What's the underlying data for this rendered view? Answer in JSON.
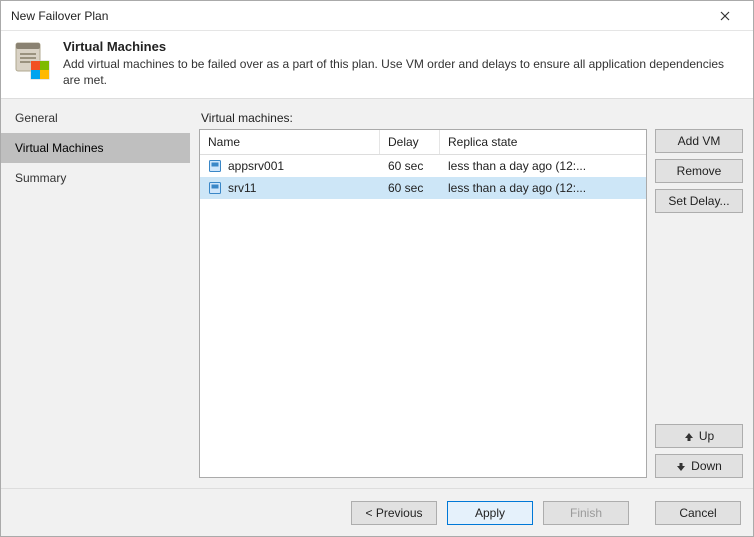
{
  "window": {
    "title": "New Failover Plan"
  },
  "header": {
    "title": "Virtual Machines",
    "description": "Add virtual machines to be failed over as a part of this plan. Use VM order and delays to ensure all application dependencies are met."
  },
  "sidebar": {
    "items": [
      {
        "label": "General",
        "active": false
      },
      {
        "label": "Virtual Machines",
        "active": true
      },
      {
        "label": "Summary",
        "active": false
      }
    ]
  },
  "main": {
    "list_label": "Virtual machines:",
    "columns": {
      "name": "Name",
      "delay": "Delay",
      "state": "Replica state"
    },
    "rows": [
      {
        "name": "appsrv001",
        "delay": "60 sec",
        "state": "less than a day ago (12:...",
        "selected": false
      },
      {
        "name": "srv11",
        "delay": "60 sec",
        "state": "less than a day ago (12:...",
        "selected": true
      }
    ]
  },
  "side_buttons": {
    "add": "Add VM",
    "remove": "Remove",
    "set_delay": "Set Delay...",
    "up": "Up",
    "down": "Down"
  },
  "footer": {
    "previous": "< Previous",
    "apply": "Apply",
    "finish": "Finish",
    "cancel": "Cancel",
    "finish_enabled": false
  }
}
